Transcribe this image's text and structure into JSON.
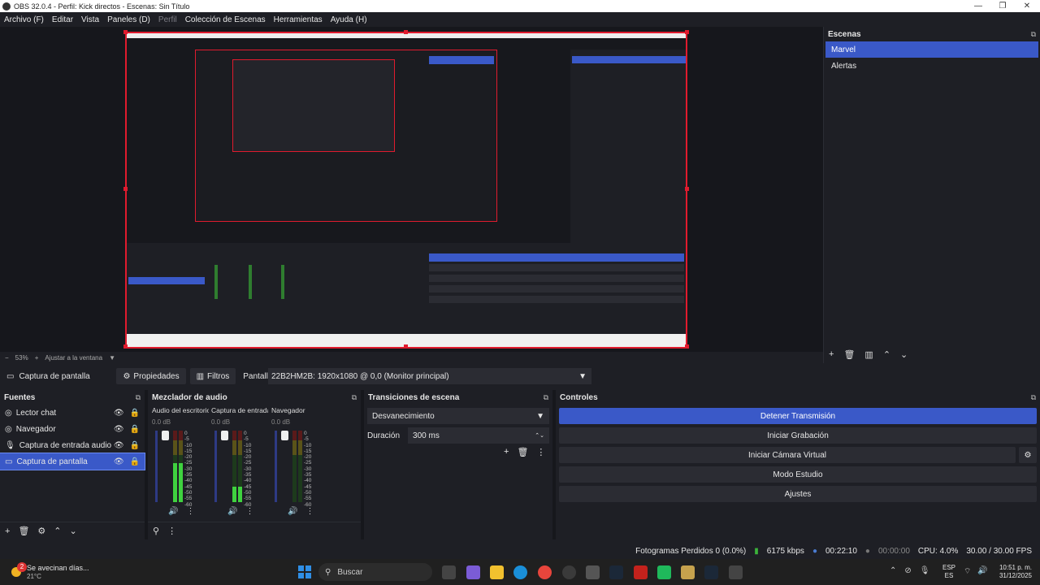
{
  "window": {
    "title": "OBS 32.0.4 - Perfil: Kick directos - Escenas: Sin Título"
  },
  "menu": [
    "Archivo (F)",
    "Editar",
    "Vista",
    "Paneles (D)",
    "Perfil",
    "Colección de Escenas",
    "Herramientas",
    "Ayuda (H)"
  ],
  "preview": {
    "zoom": "53%",
    "fit_label": "Ajustar a la ventana"
  },
  "scenes": {
    "title": "Escenas",
    "items": [
      "Marvel",
      "Alertas"
    ],
    "selected": "Marvel"
  },
  "source_bar": {
    "source_name": "Captura de pantalla",
    "properties": "Propiedades",
    "filters": "Filtros",
    "display_label": "Pantalla",
    "display_value": "22B2HM2B: 1920x1080 @ 0,0 (Monitor principal)"
  },
  "sources": {
    "title": "Fuentes",
    "items": [
      "Lector chat",
      "Navegador",
      "Captura de entrada audio",
      "Captura de pantalla"
    ],
    "selected": "Captura de pantalla"
  },
  "mixer": {
    "title": "Mezclador de audio",
    "channels": [
      {
        "name": "Audio del escritorio",
        "db": "0.0 dB",
        "level": 0.55
      },
      {
        "name": "Captura de entrada audio",
        "db": "0.0 dB",
        "level": 0.22
      },
      {
        "name": "Navegador",
        "db": "0.0 dB",
        "level": 0.0
      }
    ],
    "scale": [
      "0",
      "-5",
      "-10",
      "-15",
      "-20",
      "-25",
      "-30",
      "-35",
      "-40",
      "-45",
      "-50",
      "-55",
      "-60"
    ]
  },
  "transitions": {
    "title": "Transiciones de escena",
    "selected": "Desvanecimiento",
    "duration_label": "Duración",
    "duration_value": "300 ms"
  },
  "controls": {
    "title": "Controles",
    "buttons": [
      "Detener Transmisión",
      "Iniciar Grabación",
      "Iniciar Cámara Virtual",
      "Modo Estudio",
      "Ajustes"
    ]
  },
  "status": {
    "dropped": "Fotogramas Perdidos 0 (0.0%)",
    "bitrate": "6175 kbps",
    "stream_time": "00:22:10",
    "rec_time": "00:00:00",
    "cpu": "CPU: 4.0%",
    "fps": "30.00 / 30.00 FPS"
  },
  "taskbar": {
    "weather_title": "Se avecinan días...",
    "weather_temp": "21°C",
    "search": "Buscar",
    "lang": "ESP",
    "lang2": "ES",
    "time": "10:51 p. m.",
    "date": "31/12/2025",
    "badge": "2"
  },
  "colors": {
    "accent": "#3a59c8",
    "selection_border": "#e01b2e",
    "panel": "#1e1f25",
    "background": "#16171c"
  }
}
